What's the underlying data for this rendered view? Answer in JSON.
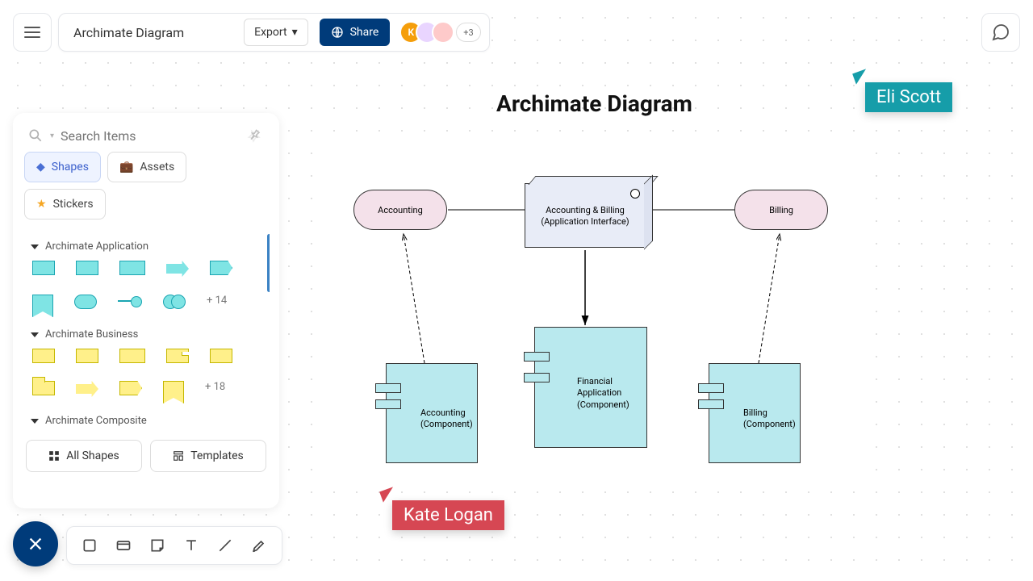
{
  "header": {
    "doc_title": "Archimate Diagram",
    "export_label": "Export",
    "share_label": "Share",
    "avatar_letter": "K",
    "more_count": "+3"
  },
  "sidebar": {
    "search_placeholder": "Search Items",
    "tabs": {
      "shapes": "Shapes",
      "assets": "Assets",
      "stickers": "Stickers"
    },
    "sections": {
      "application": "Archimate Application",
      "application_more": "+ 14",
      "business": "Archimate Business",
      "business_more": "+ 18",
      "composite": "Archimate Composite"
    },
    "footer": {
      "all_shapes": "All Shapes",
      "templates": "Templates"
    }
  },
  "diagram": {
    "title": "Archimate Diagram",
    "nodes": {
      "accounting": "Accounting",
      "billing": "Billing",
      "interface": "Accounting & Billing\n(Application Interface)",
      "accounting_component": "Accounting\n(Component)",
      "financial_component": "Financial\nApplication\n(Component)",
      "billing_component": "Billing\n(Component)"
    }
  },
  "cursors": {
    "kate": "Kate Logan",
    "eli": "Eli Scott"
  }
}
